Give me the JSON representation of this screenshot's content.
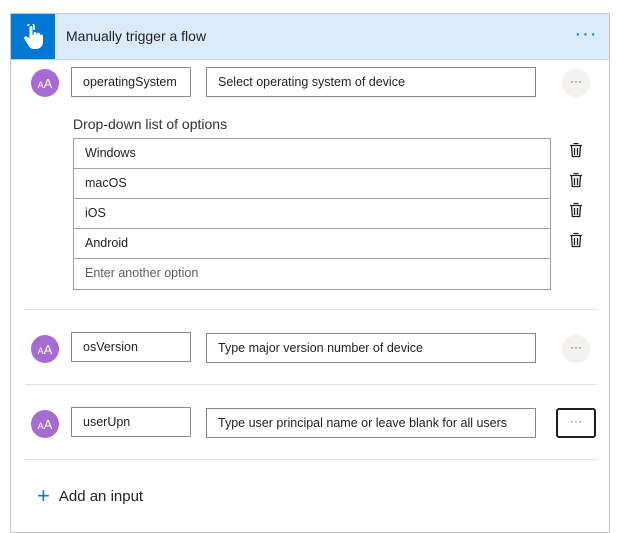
{
  "header": {
    "title": "Manually trigger a flow",
    "icon": "touch-hand-icon",
    "more_label": "···",
    "accent": "#0078d4"
  },
  "inputs": [
    {
      "avatar": "AA",
      "name": "operatingSystem",
      "description": "Select operating system of device",
      "more_label": "···",
      "options_label": "Drop-down list of options",
      "options": [
        "Windows",
        "macOS",
        "iOS",
        "Android"
      ],
      "option_placeholder": "Enter another option"
    },
    {
      "avatar": "AA",
      "name": "osVersion",
      "description": "Type major version number of device",
      "more_label": "···"
    },
    {
      "avatar": "AA",
      "name": "userUpn",
      "description": "Type user principal name or leave blank for all users",
      "more_label": "···"
    }
  ],
  "add_input": {
    "icon": "plus-icon",
    "label": "Add an input"
  }
}
